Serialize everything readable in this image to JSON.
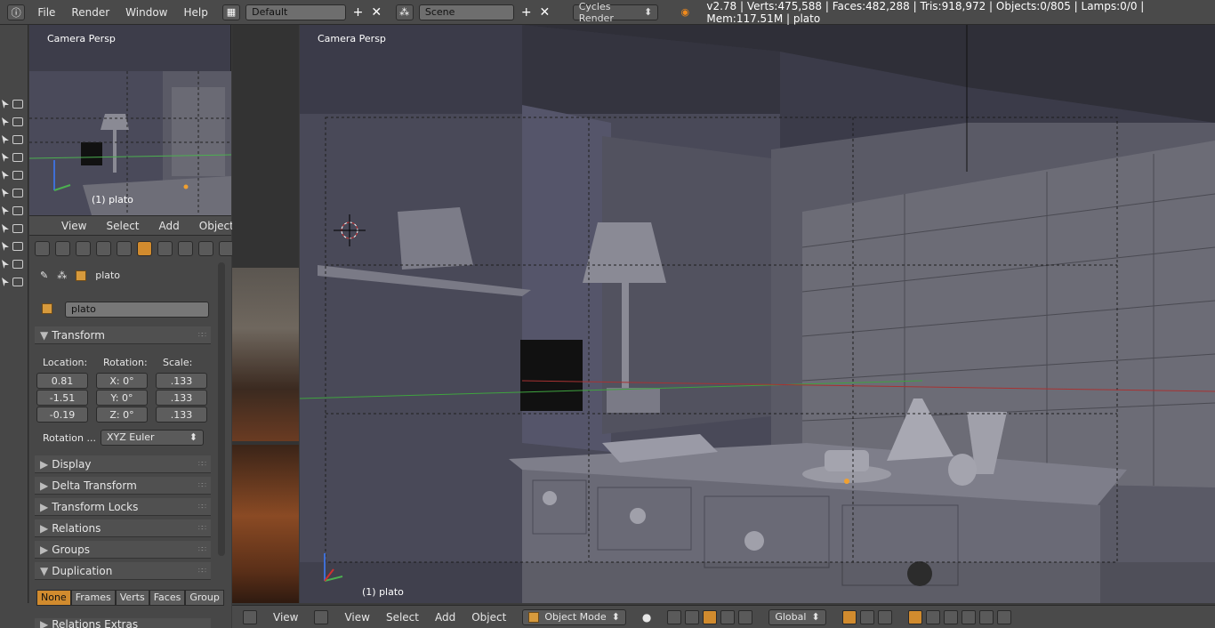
{
  "topbar": {
    "menus": [
      "File",
      "Render",
      "Window",
      "Help"
    ],
    "screen_layout": "Default",
    "scene": "Scene",
    "render_engine": "Cycles Render",
    "stats": "v2.78 | Verts:475,588 | Faces:482,288 | Tris:918,972 | Objects:0/805 | Lamps:0/0 | Mem:117.51M | plato"
  },
  "mini_viewport": {
    "label": "Camera Persp",
    "object_label": "(1) plato"
  },
  "mini_header": {
    "items": [
      "View",
      "Select",
      "Add",
      "Object"
    ]
  },
  "properties": {
    "path_object": "plato",
    "object_name": "plato",
    "transform": {
      "title": "Transform",
      "location_label": "Location:",
      "rotation_label": "Rotation:",
      "scale_label": "Scale:",
      "location": [
        "0.81",
        "-1.51",
        "-0.19"
      ],
      "rotation": [
        "X: 0°",
        "Y: 0°",
        "Z: 0°"
      ],
      "scale": [
        ".133",
        ".133",
        ".133"
      ],
      "rotation_mode_label": "Rotation ...",
      "rotation_mode": "XYZ Euler"
    },
    "sections": [
      "Display",
      "Delta Transform",
      "Transform Locks",
      "Relations",
      "Groups",
      "Duplication"
    ],
    "duplication_tabs": [
      "None",
      "Frames",
      "Verts",
      "Faces",
      "Group"
    ],
    "duplication_active": "None",
    "cutoff_section": "Relations Extras"
  },
  "main_viewport": {
    "label": "Camera Persp",
    "object_label": "(1) plato"
  },
  "bottombar": {
    "view_label": "View",
    "items": [
      "View",
      "Select",
      "Add",
      "Object"
    ],
    "mode": "Object Mode",
    "orientation": "Global"
  },
  "colors": {
    "accent": "#d18b2e",
    "header_bg": "#4a4a4a",
    "panel_bg": "#474747",
    "viewport_bg": "#3b3b49"
  }
}
